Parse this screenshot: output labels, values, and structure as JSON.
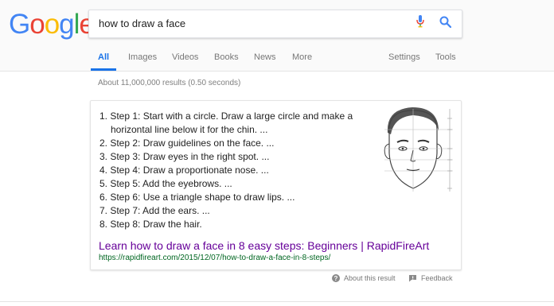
{
  "logo": {
    "text": "Google",
    "letters": [
      "G",
      "o",
      "o",
      "g",
      "l",
      "e"
    ],
    "colors": [
      "#4285F4",
      "#EA4335",
      "#FBBC05",
      "#4285F4",
      "#34A853",
      "#EA4335"
    ]
  },
  "search": {
    "query": "how to draw a face",
    "mic_icon": "mic-icon",
    "search_icon": "search-icon"
  },
  "tabs": {
    "all": "All",
    "images": "Images",
    "videos": "Videos",
    "books": "Books",
    "news": "News",
    "more": "More",
    "settings": "Settings",
    "tools": "Tools"
  },
  "stats": "About 11,000,000 results (0.50 seconds)",
  "snippet": {
    "steps": [
      "1. Step 1: Start with a circle. Draw a large circle and make a horizontal line below it for the chin. ...",
      "2. Step 2: Draw guidelines on the face. ...",
      "3. Step 3: Draw eyes in the right spot. ...",
      "4. Step 4: Draw a proportionate nose. ...",
      "5. Step 5: Add the eyebrows. ...",
      "6. Step 6: Use a triangle shape to draw lips. ...",
      "7. Step 7: Add the ears. ...",
      "8. Step 8: Draw the hair."
    ],
    "image_icon": "face-drawing-image"
  },
  "result": {
    "title": "Learn how to draw a face in 8 easy steps: Beginners | RapidFireArt",
    "url": "https://rapidfireart.com/2015/12/07/how-to-draw-a-face-in-8-steps/"
  },
  "footer": {
    "about": "About this result",
    "feedback": "Feedback"
  },
  "colors": {
    "accent": "#1a73e8",
    "visited_link": "#660099",
    "url_green": "#006621"
  }
}
